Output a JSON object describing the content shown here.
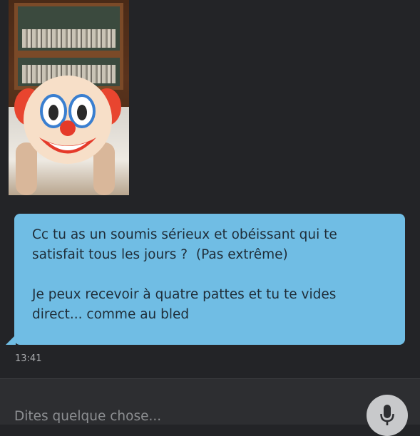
{
  "message": {
    "text": "Cc tu as un soumis sérieux et obéissant qui te\nsatisfait tous les jours ?  (Pas extrême)\n\nJe peux recevoir à quatre pattes et tu te vides\ndirect... comme au bled",
    "time": "13:41"
  },
  "composer": {
    "placeholder": "Dites quelque chose..."
  },
  "icons": {
    "mic": "microphone-icon",
    "sticker": "clown-face-icon"
  },
  "colors": {
    "background": "#232427",
    "bubble": "#70bde4",
    "composer": "#2d2e31",
    "mic_button": "#c8c9cb"
  }
}
